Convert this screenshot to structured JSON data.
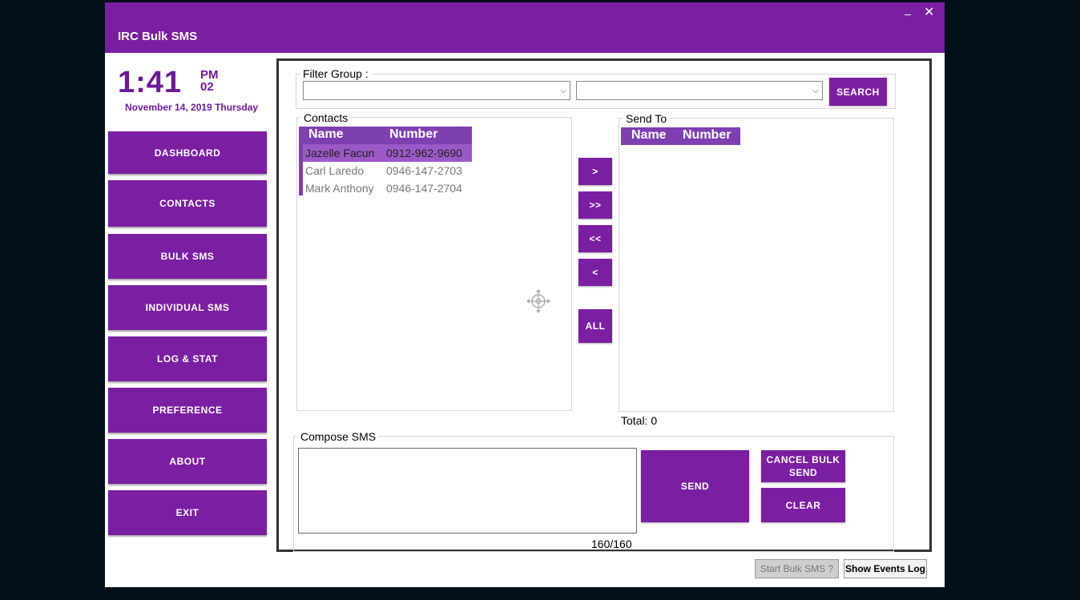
{
  "window": {
    "title": "IRC Bulk SMS",
    "minimize": "–",
    "close": "✕"
  },
  "clock": {
    "time": "1:41",
    "ampm": "PM",
    "seconds": "02",
    "date": "November 14, 2019 Thursday"
  },
  "nav": [
    {
      "label": "DASHBOARD"
    },
    {
      "label": "CONTACTS"
    },
    {
      "label": "BULK SMS"
    },
    {
      "label": "INDIVIDUAL SMS"
    },
    {
      "label": "LOG & STAT"
    },
    {
      "label": "PREFERENCE"
    },
    {
      "label": "ABOUT"
    },
    {
      "label": "EXIT"
    }
  ],
  "filter": {
    "label": "Filter Group :",
    "search": "SEARCH"
  },
  "contacts": {
    "label": "Contacts",
    "col_name": "Name",
    "col_number": "Number",
    "rows": [
      {
        "name": "Jazelle Facun",
        "number": "0912-962-9690"
      },
      {
        "name": "Carl Laredo",
        "number": "0946-147-2703"
      },
      {
        "name": "Mark Anthony",
        "number": "0946-147-2704"
      }
    ]
  },
  "transfer": {
    "add": ">",
    "add_all": ">>",
    "remove_all": "<<",
    "remove": "<",
    "all": "ALL"
  },
  "send_to": {
    "label": "Send To",
    "col_name": "Name",
    "col_number": "Number",
    "total": "Total: 0"
  },
  "compose": {
    "label": "Compose SMS",
    "counter": "160/160",
    "send": "SEND",
    "cancel": "CANCEL BULK SEND",
    "clear": "CLEAR"
  },
  "footer": {
    "start": "Start Bulk SMS ?",
    "events": "Show Events Log"
  }
}
